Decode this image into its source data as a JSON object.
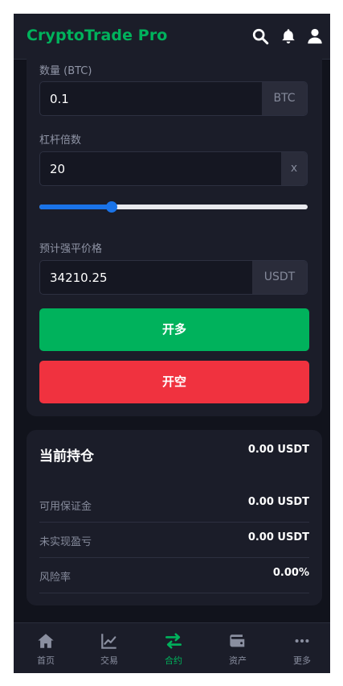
{
  "app": {
    "brand": "CryptoTrade Pro"
  },
  "header": {
    "icons": [
      "search-icon",
      "bell-icon",
      "user-icon"
    ]
  },
  "order_form": {
    "quantity": {
      "label": "数量 (BTC)",
      "value": "0.1",
      "unit": "BTC"
    },
    "leverage": {
      "label": "杠杆倍数",
      "value": "20",
      "unit": "x",
      "slider_fraction": 0.26
    },
    "liquidation": {
      "label": "预计强平价格",
      "value": "34210.25",
      "unit": "USDT"
    },
    "long_button": "开多",
    "short_button": "开空"
  },
  "position": {
    "title": "当前持仓",
    "total": "0.00 USDT",
    "rows": [
      {
        "label": "可用保证金",
        "value": "0.00 USDT"
      },
      {
        "label": "未实现盈亏",
        "value": "0.00 USDT"
      },
      {
        "label": "风险率",
        "value": "0.00%"
      }
    ]
  },
  "nav": {
    "items": [
      {
        "label": "首页",
        "icon": "home-icon"
      },
      {
        "label": "交易",
        "icon": "chart-icon"
      },
      {
        "label": "合约",
        "icon": "swap-icon",
        "active": true
      },
      {
        "label": "资产",
        "icon": "wallet-icon"
      },
      {
        "label": "更多",
        "icon": "more-icon"
      }
    ]
  },
  "colors": {
    "accent_green": "#00b25c",
    "accent_red": "#f0323f",
    "slider_blue": "#1a73e8",
    "background": "#11131c",
    "card": "#1b1d29"
  }
}
